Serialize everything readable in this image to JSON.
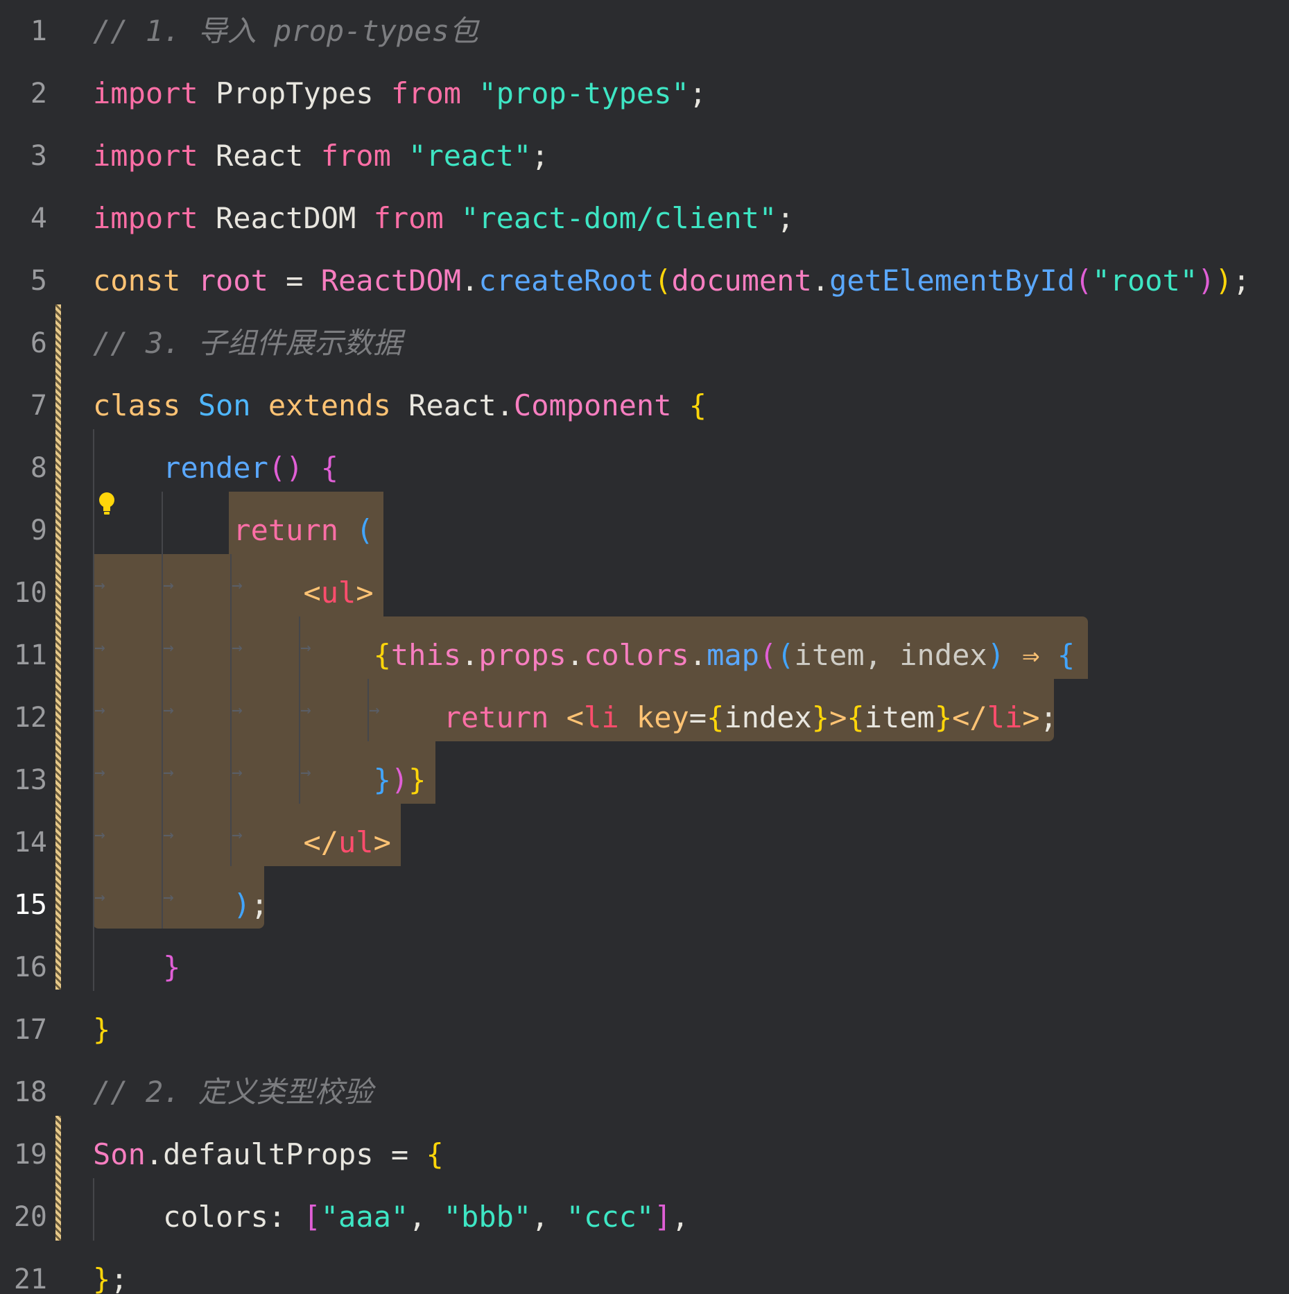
{
  "editor": {
    "language": "javascript-react",
    "active_line": 15,
    "line_numbers": [
      "1",
      "2",
      "3",
      "4",
      "5",
      "6",
      "7",
      "8",
      "9",
      "10",
      "11",
      "12",
      "13",
      "14",
      "15",
      "16",
      "17",
      "18",
      "19",
      "20",
      "21"
    ],
    "lines": [
      {
        "tokens": [
          {
            "t": "// 1. 导入 prop-types包",
            "c": "c-comment"
          }
        ]
      },
      {
        "tokens": [
          {
            "t": "import ",
            "c": "c-kw"
          },
          {
            "t": "PropTypes ",
            "c": "c-ident"
          },
          {
            "t": "from ",
            "c": "c-kw"
          },
          {
            "t": "\"prop-types\"",
            "c": "c-str"
          },
          {
            "t": ";",
            "c": "c-ident"
          }
        ]
      },
      {
        "tokens": [
          {
            "t": "import ",
            "c": "c-kw"
          },
          {
            "t": "React ",
            "c": "c-ident"
          },
          {
            "t": "from ",
            "c": "c-kw"
          },
          {
            "t": "\"react\"",
            "c": "c-str"
          },
          {
            "t": ";",
            "c": "c-ident"
          }
        ]
      },
      {
        "tokens": [
          {
            "t": "import ",
            "c": "c-kw"
          },
          {
            "t": "ReactDOM ",
            "c": "c-ident"
          },
          {
            "t": "from ",
            "c": "c-kw"
          },
          {
            "t": "\"react-dom/client\"",
            "c": "c-str"
          },
          {
            "t": ";",
            "c": "c-ident"
          }
        ]
      },
      {
        "tokens": [
          {
            "t": "const ",
            "c": "c-const"
          },
          {
            "t": "root",
            "c": "c-prop"
          },
          {
            "t": " = ",
            "c": "c-ident"
          },
          {
            "t": "ReactDOM",
            "c": "c-prop"
          },
          {
            "t": ".",
            "c": "c-ident"
          },
          {
            "t": "createRoot",
            "c": "c-fn"
          },
          {
            "t": "(",
            "c": "c-brace-y"
          },
          {
            "t": "document",
            "c": "c-prop"
          },
          {
            "t": ".",
            "c": "c-ident"
          },
          {
            "t": "getElementById",
            "c": "c-fn"
          },
          {
            "t": "(",
            "c": "c-brace-m"
          },
          {
            "t": "\"root\"",
            "c": "c-str"
          },
          {
            "t": ")",
            "c": "c-brace-m"
          },
          {
            "t": ")",
            "c": "c-brace-y"
          },
          {
            "t": ";",
            "c": "c-ident"
          }
        ]
      },
      {
        "tokens": [
          {
            "t": "// 3. 子组件展示数据",
            "c": "c-comment"
          }
        ]
      },
      {
        "tokens": [
          {
            "t": "class ",
            "c": "c-const"
          },
          {
            "t": "Son ",
            "c": "c-cls"
          },
          {
            "t": "extends ",
            "c": "c-const"
          },
          {
            "t": "React",
            "c": "c-ident"
          },
          {
            "t": ".",
            "c": "c-ident"
          },
          {
            "t": "Component ",
            "c": "c-prop"
          },
          {
            "t": "{",
            "c": "c-brace-y"
          }
        ]
      },
      {
        "tokens": [
          {
            "t": "    ",
            "c": "c-ident"
          },
          {
            "t": "render",
            "c": "c-fn"
          },
          {
            "t": "() ",
            "c": "c-brace-m"
          },
          {
            "t": "{",
            "c": "c-brace-m"
          }
        ]
      },
      {
        "tokens": [
          {
            "t": "        ",
            "c": "c-ident"
          },
          {
            "t": "return ",
            "c": "c-kw"
          },
          {
            "t": "(",
            "c": "c-brace-b"
          }
        ]
      },
      {
        "tokens": [
          {
            "t": "            ",
            "c": "c-ident"
          },
          {
            "t": "<",
            "c": "c-punct"
          },
          {
            "t": "ul",
            "c": "c-tag"
          },
          {
            "t": ">",
            "c": "c-punct"
          }
        ]
      },
      {
        "tokens": [
          {
            "t": "                ",
            "c": "c-ident"
          },
          {
            "t": "{",
            "c": "c-brace-y"
          },
          {
            "t": "this",
            "c": "c-prop"
          },
          {
            "t": ".",
            "c": "c-ident"
          },
          {
            "t": "props",
            "c": "c-prop"
          },
          {
            "t": ".",
            "c": "c-ident"
          },
          {
            "t": "colors",
            "c": "c-prop"
          },
          {
            "t": ".",
            "c": "c-ident"
          },
          {
            "t": "map",
            "c": "c-fn"
          },
          {
            "t": "(",
            "c": "c-brace-m"
          },
          {
            "t": "(",
            "c": "c-brace-b"
          },
          {
            "t": "item, index",
            "c": "c-param"
          },
          {
            "t": ") ",
            "c": "c-brace-b"
          },
          {
            "t": "⇒ ",
            "c": "c-op"
          },
          {
            "t": "{",
            "c": "c-brace-b"
          }
        ]
      },
      {
        "tokens": [
          {
            "t": "                    ",
            "c": "c-ident"
          },
          {
            "t": "return ",
            "c": "c-kw"
          },
          {
            "t": "<",
            "c": "c-punct"
          },
          {
            "t": "li ",
            "c": "c-tag"
          },
          {
            "t": "key",
            "c": "c-attr"
          },
          {
            "t": "=",
            "c": "c-ident"
          },
          {
            "t": "{",
            "c": "c-brace-y"
          },
          {
            "t": "index",
            "c": "c-ident"
          },
          {
            "t": "}",
            "c": "c-brace-y"
          },
          {
            "t": ">",
            "c": "c-punct"
          },
          {
            "t": "{",
            "c": "c-brace-y"
          },
          {
            "t": "item",
            "c": "c-ident"
          },
          {
            "t": "}",
            "c": "c-brace-y"
          },
          {
            "t": "</",
            "c": "c-punct"
          },
          {
            "t": "li",
            "c": "c-tag"
          },
          {
            "t": ">",
            "c": "c-punct"
          },
          {
            "t": ";",
            "c": "c-ident"
          }
        ]
      },
      {
        "tokens": [
          {
            "t": "                ",
            "c": "c-ident"
          },
          {
            "t": "}",
            "c": "c-brace-b"
          },
          {
            "t": ")",
            "c": "c-brace-m"
          },
          {
            "t": "}",
            "c": "c-brace-y"
          }
        ]
      },
      {
        "tokens": [
          {
            "t": "            ",
            "c": "c-ident"
          },
          {
            "t": "</",
            "c": "c-punct"
          },
          {
            "t": "ul",
            "c": "c-tag"
          },
          {
            "t": ">",
            "c": "c-punct"
          }
        ]
      },
      {
        "tokens": [
          {
            "t": "        ",
            "c": "c-ident"
          },
          {
            "t": ")",
            "c": "c-brace-b"
          },
          {
            "t": ";",
            "c": "c-ident"
          }
        ]
      },
      {
        "tokens": [
          {
            "t": "    ",
            "c": "c-ident"
          },
          {
            "t": "}",
            "c": "c-brace-m"
          }
        ]
      },
      {
        "tokens": [
          {
            "t": "}",
            "c": "c-brace-y"
          }
        ]
      },
      {
        "tokens": [
          {
            "t": "// 2. 定义类型校验",
            "c": "c-comment"
          }
        ]
      },
      {
        "tokens": [
          {
            "t": "Son",
            "c": "c-prop"
          },
          {
            "t": ".",
            "c": "c-ident"
          },
          {
            "t": "defaultProps",
            "c": "c-ident"
          },
          {
            "t": " = ",
            "c": "c-ident"
          },
          {
            "t": "{",
            "c": "c-brace-y"
          }
        ]
      },
      {
        "tokens": [
          {
            "t": "    ",
            "c": "c-ident"
          },
          {
            "t": "colors",
            "c": "c-ident"
          },
          {
            "t": ": ",
            "c": "c-ident"
          },
          {
            "t": "[",
            "c": "c-brace-m"
          },
          {
            "t": "\"aaa\"",
            "c": "c-str"
          },
          {
            "t": ", ",
            "c": "c-ident"
          },
          {
            "t": "\"bbb\"",
            "c": "c-str"
          },
          {
            "t": ", ",
            "c": "c-ident"
          },
          {
            "t": "\"ccc\"",
            "c": "c-str"
          },
          {
            "t": "]",
            "c": "c-brace-m"
          },
          {
            "t": ",",
            "c": "c-ident"
          }
        ]
      },
      {
        "tokens": [
          {
            "t": "}",
            "c": "c-brace-y"
          },
          {
            "t": ";",
            "c": "c-ident"
          }
        ]
      }
    ],
    "colors": {
      "background": "#2b2c2f",
      "selection": "#5d4e3b",
      "modified_marker": "#e7c98a",
      "lightbulb": "#ffd60a"
    },
    "icons": {
      "lightbulb": "lightbulb-icon",
      "whitespace_tab": "tab-arrow-icon"
    }
  }
}
